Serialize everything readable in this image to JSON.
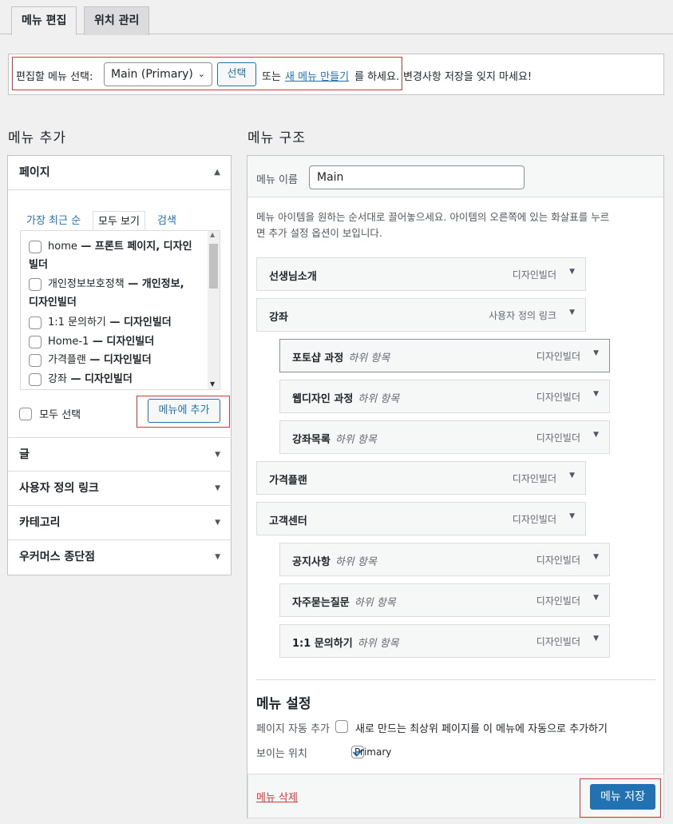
{
  "tabs": [
    {
      "label": "메뉴 편집"
    },
    {
      "label": "위치 관리"
    }
  ],
  "select_bar": {
    "label": "편집할 메뉴 선택:",
    "selected_menu": "Main (Primary)",
    "select_button": "선택",
    "or_text": "또는",
    "new_menu_link": "새 메뉴 만들기",
    "suffix": "를 하세요.",
    "reminder": "변경사항 저장을 잊지 마세요!"
  },
  "add_menu": {
    "title": "메뉴 추가",
    "pages_section": {
      "title": "페이지",
      "tabs": [
        "가장 최근 순",
        "모두 보기",
        "검색"
      ],
      "items": [
        {
          "name": "home",
          "suffix": " — 프론트 페이지, 디자인",
          "line2": "빌더"
        },
        {
          "name": "개인정보보호정책",
          "suffix": " — 개인정보,",
          "line2": "디자인빌더"
        },
        {
          "name": "1:1 문의하기",
          "suffix": " — 디자인빌더",
          "line2": ""
        },
        {
          "name": "Home-1",
          "suffix": " — 디자인빌더",
          "line2": ""
        },
        {
          "name": "가격플랜",
          "suffix": " — 디자인빌더",
          "line2": ""
        },
        {
          "name": "강좌",
          "suffix": " — 디자인빌더",
          "line2": ""
        }
      ],
      "select_all": "모두 선택",
      "add_button": "메뉴에 추가"
    },
    "other_sections": [
      "글",
      "사용자 정의 링크",
      "카테고리",
      "우커머스 종단점"
    ]
  },
  "menu_structure": {
    "title": "메뉴 구조",
    "name_label": "메뉴 이름",
    "name_value": "Main",
    "instructions": "메뉴 아이템을 원하는 순서대로 끌어놓으세요. 아이템의 오른쪽에 있는 화살표를 누르면 추가 설정 옵션이 보입니다.",
    "instructions_line1": "메뉴 아이템을 원하는 순서대로 끌어놓으세요. 아이템의 오른쪽에 있는 화살표를 누르",
    "instructions_line2": "면 추가 설정 옵션이 보입니다.",
    "items": [
      {
        "title": "선생님소개",
        "sub": "",
        "kind": "디자인빌더"
      },
      {
        "title": "강좌",
        "sub": "",
        "kind": "사용자 정의 링크"
      },
      {
        "title": "포토샵 과정",
        "sub": "하위 항목",
        "kind": "디자인빌더"
      },
      {
        "title": "웹디자인 과정",
        "sub": "하위 항목",
        "kind": "디자인빌더"
      },
      {
        "title": "강좌목록",
        "sub": "하위 항목",
        "kind": "디자인빌더"
      },
      {
        "title": "가격플랜",
        "sub": "",
        "kind": "디자인빌더"
      },
      {
        "title": "고객센터",
        "sub": "",
        "kind": "디자인빌더"
      },
      {
        "title": "공지사항",
        "sub": "하위 항목",
        "kind": "디자인빌더"
      },
      {
        "title": "자주묻는질문",
        "sub": "하위 항목",
        "kind": "디자인빌더"
      },
      {
        "title": "1:1 문의하기",
        "sub": "하위 항목",
        "kind": "디자인빌더"
      }
    ]
  },
  "menu_settings": {
    "title": "메뉴 설정",
    "auto_add_label": "페이지 자동 추가",
    "auto_add_text": "새로 만드는 최상위 페이지를 이 메뉴에 자동으로 추가하기",
    "location_label": "보이는 위치",
    "location_value": "Primary",
    "location_checked": true
  },
  "footer": {
    "delete_link": "메뉴 삭제",
    "save_button": "메뉴 저장"
  },
  "colors": {
    "accent": "#2271b1",
    "highlight_border": "#d63638",
    "danger": "#d63638"
  }
}
